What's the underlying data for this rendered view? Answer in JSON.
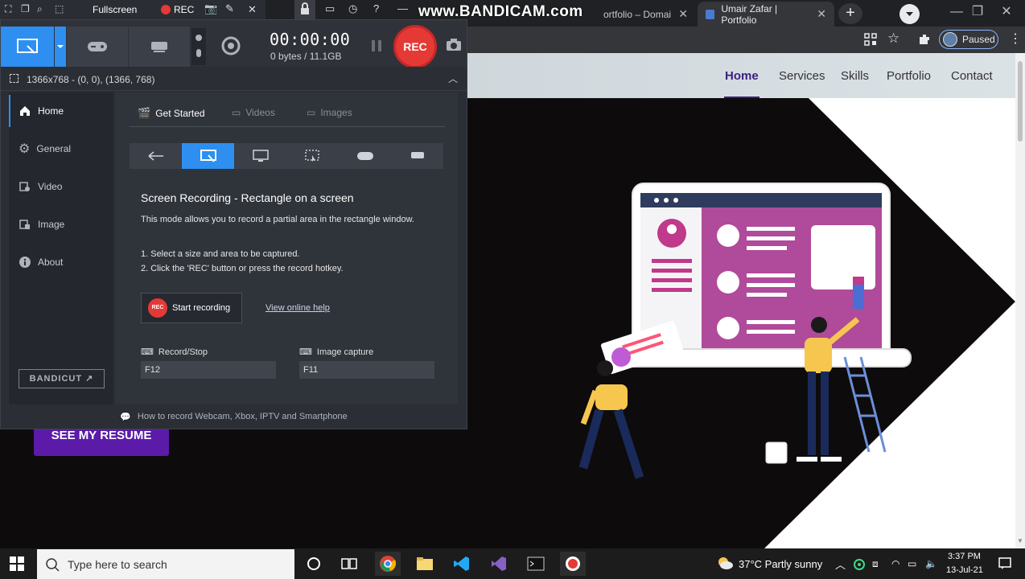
{
  "bandicam_topbar": {
    "fullscreen_label": "Fullscreen",
    "rec_label": "REC"
  },
  "watermark": "www.BANDICAM.com",
  "browser": {
    "tabs": [
      {
        "title": "ortfolio – Domai"
      },
      {
        "title": "Umair Zafar | Portfolio"
      }
    ],
    "profile_status": "Paused"
  },
  "site": {
    "nav": [
      "Home",
      "Services",
      "Skills",
      "Portfolio",
      "Contact"
    ],
    "resume_button": "SEE MY RESUME"
  },
  "bandicam": {
    "timer": "00:00:00",
    "bytes": "0 bytes / 11.1GB",
    "rec_button": "REC",
    "area_info": "1366x768 - (0, 0), (1366, 768)",
    "sidebar": [
      "Home",
      "General",
      "Video",
      "Image",
      "About"
    ],
    "subtabs": [
      "Get Started",
      "Videos",
      "Images"
    ],
    "mode_title": "Screen Recording - Rectangle on a screen",
    "mode_desc": "This mode allows you to record a partial area in the rectangle window.",
    "step1": "1. Select a size and area to be captured.",
    "step2": "2. Click the 'REC' button or press the record hotkey.",
    "start_button": "Start recording",
    "start_icon_text": "REC",
    "help_link": "View online help",
    "record_stop_label": "Record/Stop",
    "record_stop_key": "F12",
    "image_capture_label": "Image capture",
    "image_capture_key": "F11",
    "bandicut": "BANDICUT",
    "bottom_tip": "How to record Webcam, Xbox, IPTV and Smartphone"
  },
  "taskbar": {
    "search_placeholder": "Type here to search",
    "weather": "37°C  Partly sunny",
    "time": "3:37 PM",
    "date": "13-Jul-21"
  }
}
